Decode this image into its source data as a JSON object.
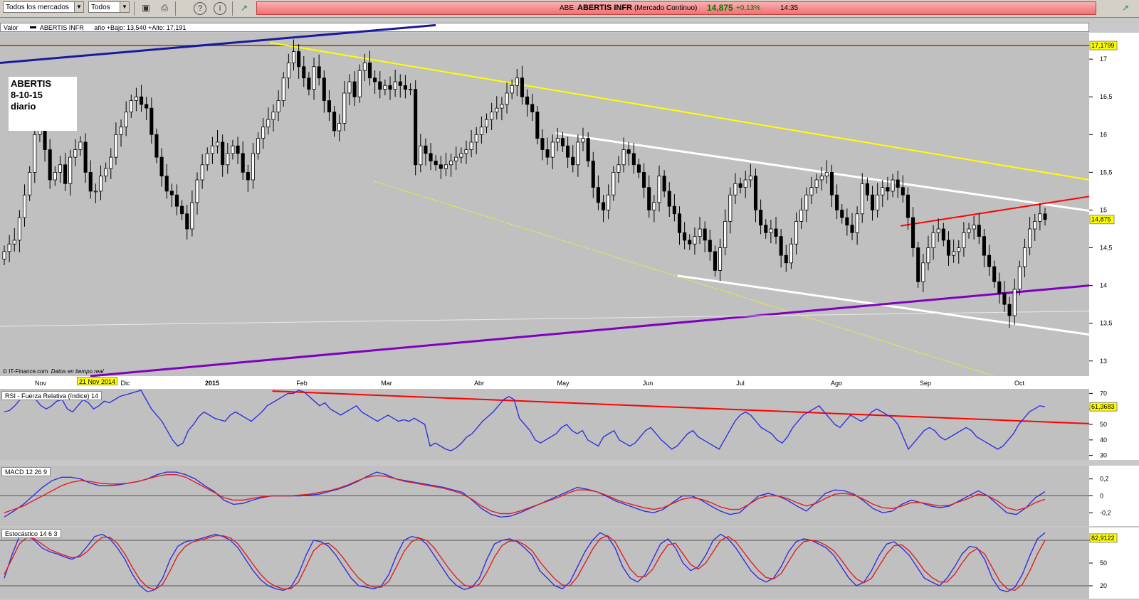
{
  "toolbar": {
    "market_select": "Todos los mercados",
    "type_select": "Todos",
    "icons": [
      "save-icon",
      "print-icon",
      "help-icon",
      "info-icon",
      "chart-icon",
      "chart-icon"
    ]
  },
  "ticker": {
    "symbol": "ABE",
    "name": "ABERTIS INFR",
    "market": "(Mercado Continuo)",
    "price": "14,875",
    "change": "+0,13%",
    "time": "14:35"
  },
  "price_panel": {
    "header_label": "Valor",
    "header_series": "ABERTIS INFR",
    "header_range": "año +Bajo: 13,540 +Alto: 17,191",
    "note_lines": [
      "ABERTIS",
      "8-10-15",
      "diario"
    ],
    "source": "IT-Finance.com",
    "source_suffix": "Datos en tiempo real",
    "date_badge": "21 Nov 2014",
    "max_label": "17,1799",
    "last_label": "14,875"
  },
  "rsi_panel": {
    "header": "RSI - Fuerza Relativa (índice) 14",
    "value_label": "61,3683"
  },
  "macd_panel": {
    "header": "MACD 12 26 9"
  },
  "stoch_panel": {
    "header": "Estocástico 14 6 3",
    "value_label": "82,9122"
  },
  "colors": {
    "chart_bg": "#c0c0c0",
    "rsi_line": "#3030e0",
    "signal_line": "#e02020",
    "trend_yellow": "#ffff00",
    "trend_white": "#ffffff",
    "trend_purple": "#8000c0",
    "trend_red": "#ff0000",
    "trend_blue": "#1a1aa0",
    "resistance_brown": "#a05a28"
  },
  "chart_data": [
    {
      "type": "candlestick",
      "x_ticks": [
        "Nov",
        "Dic",
        "2015",
        "Feb",
        "Mar",
        "Abr",
        "May",
        "Jun",
        "Jul",
        "Ago",
        "Sep",
        "Oct"
      ],
      "y_ticks": [
        "13",
        "13,5",
        "14",
        "14,5",
        "15",
        "15,5",
        "16",
        "16,5",
        "17"
      ],
      "ylim": [
        12.8,
        17.35
      ],
      "close": [
        14.45,
        14.55,
        14.6,
        14.9,
        15.2,
        15.5,
        16.0,
        16.1,
        15.8,
        15.4,
        15.5,
        15.6,
        15.35,
        15.7,
        15.8,
        15.9,
        15.5,
        15.25,
        15.25,
        15.45,
        15.55,
        15.7,
        16.0,
        16.1,
        16.3,
        16.45,
        16.5,
        16.4,
        16.35,
        16.0,
        15.7,
        15.45,
        15.25,
        15.2,
        15.05,
        14.95,
        14.75,
        15.1,
        15.4,
        15.6,
        15.75,
        15.85,
        15.9,
        15.6,
        15.75,
        15.85,
        15.75,
        15.5,
        15.4,
        15.75,
        15.95,
        16.1,
        16.2,
        16.3,
        16.45,
        16.75,
        16.95,
        17.1,
        16.9,
        16.75,
        16.6,
        16.9,
        16.75,
        16.45,
        16.3,
        16.05,
        16.15,
        16.55,
        16.7,
        16.5,
        16.85,
        16.95,
        16.75,
        16.7,
        16.6,
        16.65,
        16.6,
        16.7,
        16.65,
        16.6,
        16.6,
        15.6,
        15.85,
        15.75,
        15.65,
        15.6,
        15.55,
        15.6,
        15.65,
        15.7,
        15.75,
        15.8,
        15.9,
        16.0,
        16.1,
        16.2,
        16.3,
        16.35,
        16.4,
        16.55,
        16.65,
        16.75,
        16.5,
        16.4,
        16.3,
        15.95,
        15.8,
        15.7,
        15.9,
        15.95,
        15.85,
        15.7,
        15.6,
        15.9,
        15.95,
        15.65,
        15.3,
        15.1,
        15.0,
        15.2,
        15.5,
        15.6,
        15.8,
        15.75,
        15.6,
        15.5,
        15.3,
        15.0,
        15.1,
        15.45,
        15.25,
        15.05,
        14.95,
        14.7,
        14.6,
        14.55,
        14.65,
        14.75,
        14.6,
        14.45,
        14.2,
        14.5,
        14.85,
        15.2,
        15.35,
        15.3,
        15.4,
        15.45,
        15.0,
        14.8,
        14.7,
        14.75,
        14.65,
        14.4,
        14.3,
        14.55,
        14.85,
        15.0,
        15.2,
        15.3,
        15.4,
        15.45,
        15.5,
        15.2,
        15.0,
        14.9,
        14.8,
        14.7,
        14.95,
        15.35,
        15.2,
        15.0,
        15.2,
        15.3,
        15.25,
        15.4,
        15.3,
        15.2,
        14.9,
        14.5,
        14.05,
        14.3,
        14.5,
        14.7,
        14.75,
        14.6,
        14.4,
        14.45,
        14.5,
        14.7,
        14.75,
        14.8,
        14.65,
        14.4,
        14.25,
        14.05,
        13.9,
        13.75,
        13.6,
        13.95,
        14.25,
        14.5,
        14.75,
        14.85,
        14.95,
        14.875
      ],
      "overlays": [
        {
          "name": "resistance",
          "level": 17.1799
        },
        {
          "name": "trend_yellow",
          "from": [
            0.2475,
            17.22
          ],
          "to": [
            1.0,
            15.4
          ]
        },
        {
          "name": "trend_yellow_thin",
          "from": [
            0.344,
            15.38
          ],
          "to": [
            0.913,
            12.8
          ]
        },
        {
          "name": "channel_upper",
          "from": [
            0.51,
            16.02
          ],
          "to": [
            1.0,
            14.99
          ]
        },
        {
          "name": "channel_lower",
          "from": [
            0.622,
            14.13
          ],
          "to": [
            1.0,
            13.35
          ]
        },
        {
          "name": "trend_purple",
          "from": [
            0.083,
            12.8
          ],
          "to": [
            1.0,
            14.0
          ]
        },
        {
          "name": "trend_red",
          "from": [
            0.827,
            14.79
          ],
          "to": [
            1.0,
            15.18
          ]
        },
        {
          "name": "trend_blue",
          "from": [
            0.0,
            16.95
          ],
          "to": [
            0.4,
            17.45
          ]
        },
        {
          "name": "mm_gray",
          "from": [
            0.0,
            13.46
          ],
          "to": [
            1.0,
            13.66
          ]
        }
      ]
    },
    {
      "type": "line",
      "name": "RSI",
      "y_ticks": [
        "30",
        "40",
        "50",
        "60",
        "70"
      ],
      "ylim": [
        28,
        72
      ],
      "values": [
        58,
        59,
        62,
        66,
        69,
        71,
        66,
        62,
        60,
        62,
        65,
        66,
        60,
        58,
        62,
        66,
        64,
        60,
        62,
        65,
        64,
        66,
        68,
        69,
        70,
        71,
        72,
        66,
        60,
        56,
        52,
        46,
        40,
        36,
        38,
        46,
        50,
        55,
        58,
        56,
        54,
        53,
        52,
        56,
        58,
        56,
        54,
        52,
        55,
        58,
        62,
        64,
        66,
        68,
        70,
        70,
        72,
        71,
        68,
        65,
        62,
        64,
        60,
        58,
        56,
        58,
        60,
        62,
        58,
        56,
        54,
        52,
        54,
        56,
        54,
        52,
        53,
        52,
        54,
        52,
        50,
        36,
        38,
        36,
        34,
        33,
        35,
        38,
        42,
        44,
        48,
        52,
        55,
        58,
        62,
        66,
        68,
        66,
        54,
        50,
        46,
        40,
        38,
        40,
        42,
        44,
        48,
        50,
        46,
        44,
        46,
        40,
        38,
        36,
        42,
        44,
        46,
        40,
        38,
        36,
        38,
        42,
        46,
        48,
        44,
        40,
        37,
        34,
        36,
        40,
        44,
        46,
        42,
        40,
        38,
        36,
        34,
        40,
        46,
        52,
        56,
        58,
        56,
        52,
        48,
        46,
        44,
        40,
        38,
        42,
        48,
        52,
        56,
        58,
        60,
        62,
        58,
        54,
        50,
        48,
        52,
        56,
        54,
        52,
        54,
        58,
        60,
        58,
        56,
        54,
        50,
        42,
        34,
        38,
        42,
        46,
        48,
        46,
        42,
        40,
        42,
        44,
        46,
        48,
        46,
        42,
        40,
        38,
        36,
        34,
        36,
        40,
        44,
        50,
        54,
        58,
        60,
        62,
        61.37
      ],
      "value_label": 61.3683,
      "trend": {
        "from": [
          0.25,
          71.5
        ],
        "to": [
          1.0,
          50.5
        ]
      }
    },
    {
      "type": "line",
      "name": "MACD",
      "y_ticks": [
        "-0,2",
        "0",
        "0,2"
      ],
      "ylim": [
        -0.34,
        0.34
      ],
      "series": [
        {
          "values": [
            -0.25,
            -0.18,
            -0.1,
            0.0,
            0.1,
            0.18,
            0.22,
            0.22,
            0.2,
            0.15,
            0.12,
            0.12,
            0.13,
            0.15,
            0.17,
            0.2,
            0.25,
            0.28,
            0.28,
            0.25,
            0.2,
            0.12,
            0.05,
            -0.05,
            -0.1,
            -0.09,
            -0.05,
            -0.02,
            0.0,
            0.0,
            0.0,
            0.0,
            0.01,
            0.02,
            0.05,
            0.08,
            0.12,
            0.17,
            0.23,
            0.28,
            0.25,
            0.2,
            0.18,
            0.16,
            0.14,
            0.12,
            0.1,
            0.07,
            0.04,
            -0.05,
            -0.15,
            -0.22,
            -0.25,
            -0.24,
            -0.2,
            -0.15,
            -0.1,
            -0.05,
            0.0,
            0.05,
            0.1,
            0.08,
            0.05,
            0.0,
            -0.06,
            -0.1,
            -0.14,
            -0.18,
            -0.2,
            -0.16,
            -0.08,
            0.0,
            0.0,
            -0.05,
            -0.12,
            -0.18,
            -0.22,
            -0.2,
            -0.1,
            0.0,
            0.03,
            0.0,
            -0.05,
            -0.12,
            -0.18,
            -0.08,
            0.03,
            0.07,
            0.06,
            0.02,
            -0.06,
            -0.15,
            -0.2,
            -0.18,
            -0.1,
            -0.05,
            -0.08,
            -0.12,
            -0.14,
            -0.12,
            -0.06,
            0.0,
            0.06,
            0.0,
            -0.1,
            -0.2,
            -0.22,
            -0.14,
            -0.02,
            0.05
          ]
        },
        {
          "values": [
            -0.2,
            -0.16,
            -0.12,
            -0.06,
            0.0,
            0.06,
            0.12,
            0.16,
            0.18,
            0.17,
            0.15,
            0.14,
            0.14,
            0.15,
            0.17,
            0.2,
            0.23,
            0.25,
            0.25,
            0.22,
            0.16,
            0.1,
            0.04,
            -0.02,
            -0.05,
            -0.05,
            -0.03,
            -0.01,
            0.0,
            0.0,
            0.0,
            0.01,
            0.02,
            0.04,
            0.06,
            0.09,
            0.13,
            0.18,
            0.22,
            0.24,
            0.23,
            0.2,
            0.17,
            0.15,
            0.13,
            0.11,
            0.09,
            0.06,
            0.02,
            -0.04,
            -0.12,
            -0.18,
            -0.21,
            -0.21,
            -0.18,
            -0.14,
            -0.1,
            -0.06,
            -0.02,
            0.03,
            0.07,
            0.07,
            0.05,
            0.01,
            -0.04,
            -0.08,
            -0.11,
            -0.14,
            -0.16,
            -0.14,
            -0.09,
            -0.04,
            -0.02,
            -0.04,
            -0.08,
            -0.13,
            -0.16,
            -0.16,
            -0.1,
            -0.03,
            0.0,
            0.0,
            -0.03,
            -0.08,
            -0.12,
            -0.09,
            -0.03,
            0.02,
            0.03,
            0.01,
            -0.04,
            -0.1,
            -0.14,
            -0.15,
            -0.12,
            -0.08,
            -0.08,
            -0.1,
            -0.12,
            -0.11,
            -0.07,
            -0.03,
            0.02,
            0.0,
            -0.06,
            -0.14,
            -0.17,
            -0.14,
            -0.08,
            -0.04
          ]
        }
      ]
    },
    {
      "type": "line",
      "name": "Estocástico",
      "y_ticks": [
        "20",
        "50",
        "80"
      ],
      "ylim": [
        5,
        95
      ],
      "series": [
        {
          "values": [
            30,
            60,
            85,
            88,
            80,
            70,
            65,
            62,
            58,
            55,
            60,
            72,
            85,
            88,
            82,
            70,
            55,
            35,
            20,
            12,
            15,
            30,
            55,
            72,
            78,
            80,
            82,
            85,
            88,
            85,
            80,
            70,
            55,
            40,
            28,
            20,
            16,
            14,
            18,
            35,
            60,
            80,
            78,
            72,
            60,
            45,
            30,
            20,
            18,
            16,
            20,
            35,
            60,
            80,
            85,
            83,
            75,
            60,
            45,
            30,
            20,
            15,
            18,
            30,
            55,
            75,
            80,
            82,
            78,
            70,
            60,
            40,
            30,
            20,
            16,
            25,
            45,
            65,
            80,
            90,
            85,
            70,
            45,
            30,
            25,
            35,
            55,
            75,
            82,
            70,
            50,
            40,
            45,
            60,
            80,
            88,
            82,
            70,
            55,
            40,
            30,
            25,
            30,
            45,
            65,
            78,
            82,
            80,
            75,
            70,
            60,
            45,
            30,
            20,
            25,
            40,
            60,
            75,
            78,
            70,
            60,
            45,
            30,
            25,
            20,
            30,
            45,
            62,
            72,
            70,
            55,
            30,
            15,
            12,
            18,
            35,
            60,
            82,
            90
          ]
        },
        {
          "values": [
            35,
            55,
            75,
            84,
            82,
            75,
            68,
            64,
            60,
            57,
            58,
            65,
            76,
            84,
            84,
            76,
            62,
            44,
            28,
            18,
            15,
            22,
            40,
            60,
            72,
            78,
            80,
            83,
            86,
            86,
            83,
            75,
            62,
            48,
            35,
            25,
            19,
            16,
            16,
            25,
            45,
            66,
            75,
            76,
            68,
            56,
            42,
            30,
            22,
            18,
            18,
            26,
            45,
            65,
            78,
            83,
            80,
            70,
            56,
            42,
            30,
            21,
            18,
            22,
            38,
            58,
            73,
            79,
            79,
            74,
            66,
            52,
            40,
            29,
            21,
            20,
            32,
            50,
            68,
            82,
            86,
            78,
            60,
            42,
            32,
            32,
            42,
            60,
            74,
            76,
            62,
            48,
            42,
            50,
            65,
            80,
            85,
            78,
            65,
            52,
            40,
            31,
            29,
            36,
            52,
            68,
            78,
            80,
            78,
            73,
            66,
            54,
            40,
            29,
            24,
            30,
            46,
            62,
            73,
            74,
            66,
            54,
            40,
            31,
            25,
            25,
            35,
            50,
            63,
            69,
            62,
            44,
            26,
            16,
            14,
            22,
            40,
            62,
            80
          ]
        }
      ],
      "value_label": 82.9122
    }
  ]
}
